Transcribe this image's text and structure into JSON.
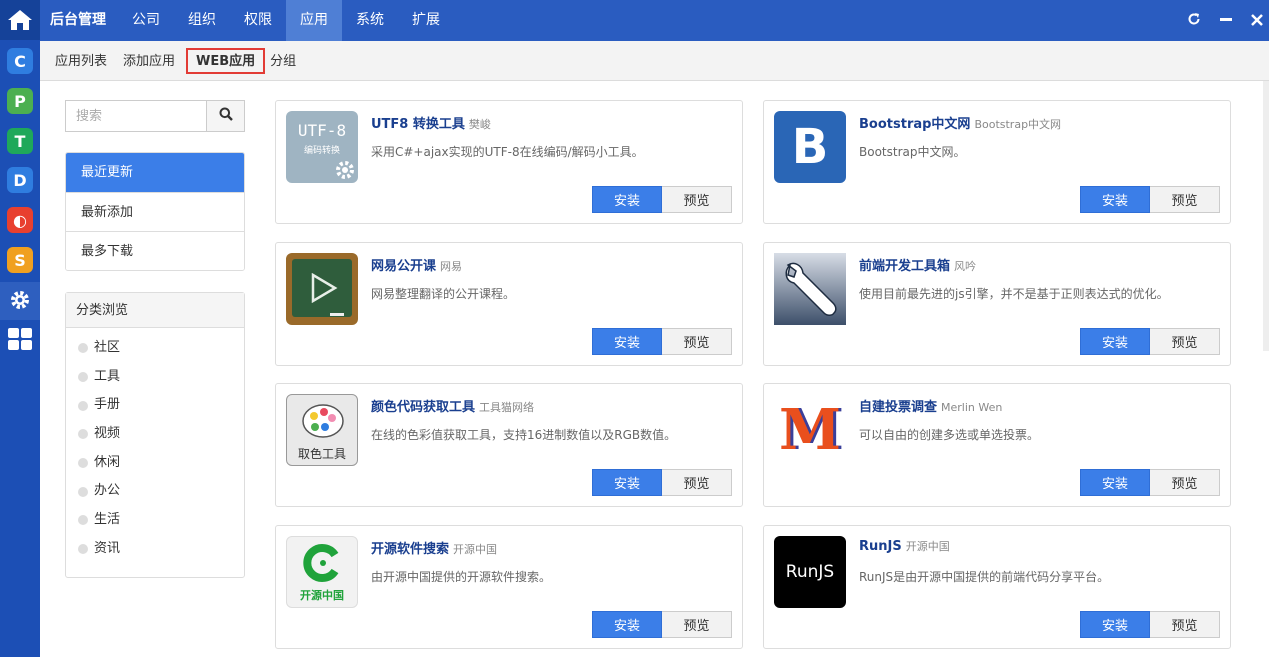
{
  "topbar": {
    "brand": "后台管理",
    "nav": [
      "公司",
      "组织",
      "权限",
      "应用",
      "系统",
      "扩展"
    ],
    "active_nav": "应用"
  },
  "dock": {
    "apps": [
      {
        "letter": "C",
        "color": "#2f7de0"
      },
      {
        "letter": "P",
        "color": "#4caf50"
      },
      {
        "letter": "T",
        "color": "#1fa85a"
      },
      {
        "letter": "D",
        "color": "#2f7de0"
      },
      {
        "letter": "◐",
        "color": "#e8402f"
      },
      {
        "letter": "S",
        "color": "#f0a020"
      }
    ]
  },
  "subnav": {
    "items": [
      "应用列表",
      "添加应用",
      "WEB应用",
      "分组"
    ],
    "selected": "WEB应用"
  },
  "sidebar": {
    "search_placeholder": "搜索",
    "filters": [
      "最近更新",
      "最新添加",
      "最多下载"
    ],
    "category_title": "分类浏览",
    "categories": [
      "社区",
      "工具",
      "手册",
      "视频",
      "休闲",
      "办公",
      "生活",
      "资讯"
    ]
  },
  "buttons": {
    "install": "安装",
    "preview": "预览"
  },
  "apps": [
    {
      "name": "UTF8 转换工具",
      "author": "樊峻",
      "desc": "采用C#+ajax实现的UTF-8在线编码/解码小工具。",
      "icon_text": "UTF-8",
      "icon_sub": "编码转换"
    },
    {
      "name": "Bootstrap中文网",
      "author": "Bootstrap中文网",
      "desc": "Bootstrap中文网。",
      "icon_text": "B"
    },
    {
      "name": "网易公开课",
      "author": "网易",
      "desc": "网易整理翻译的公开课程。"
    },
    {
      "name": "前端开发工具箱",
      "author": "风吟",
      "desc": "使用目前最先进的js引擎，并不是基于正则表达式的优化。"
    },
    {
      "name": "颜色代码获取工具",
      "author": "工具猫网络",
      "desc": "在线的色彩值获取工具，支持16进制数值以及RGB数值。",
      "icon_text": "取色工具"
    },
    {
      "name": "自建投票调查",
      "author": "Merlin Wen",
      "desc": "可以自由的创建多选或单选投票。",
      "icon_text": "M"
    },
    {
      "name": "开源软件搜索",
      "author": "开源中国",
      "desc": "由开源中国提供的开源软件搜索。",
      "icon_text": "开源中国"
    },
    {
      "name": "RunJS",
      "author": "开源中国",
      "desc": "RunJS是由开源中国提供的前端代码分享平台。",
      "icon_text": "RunJS"
    }
  ]
}
